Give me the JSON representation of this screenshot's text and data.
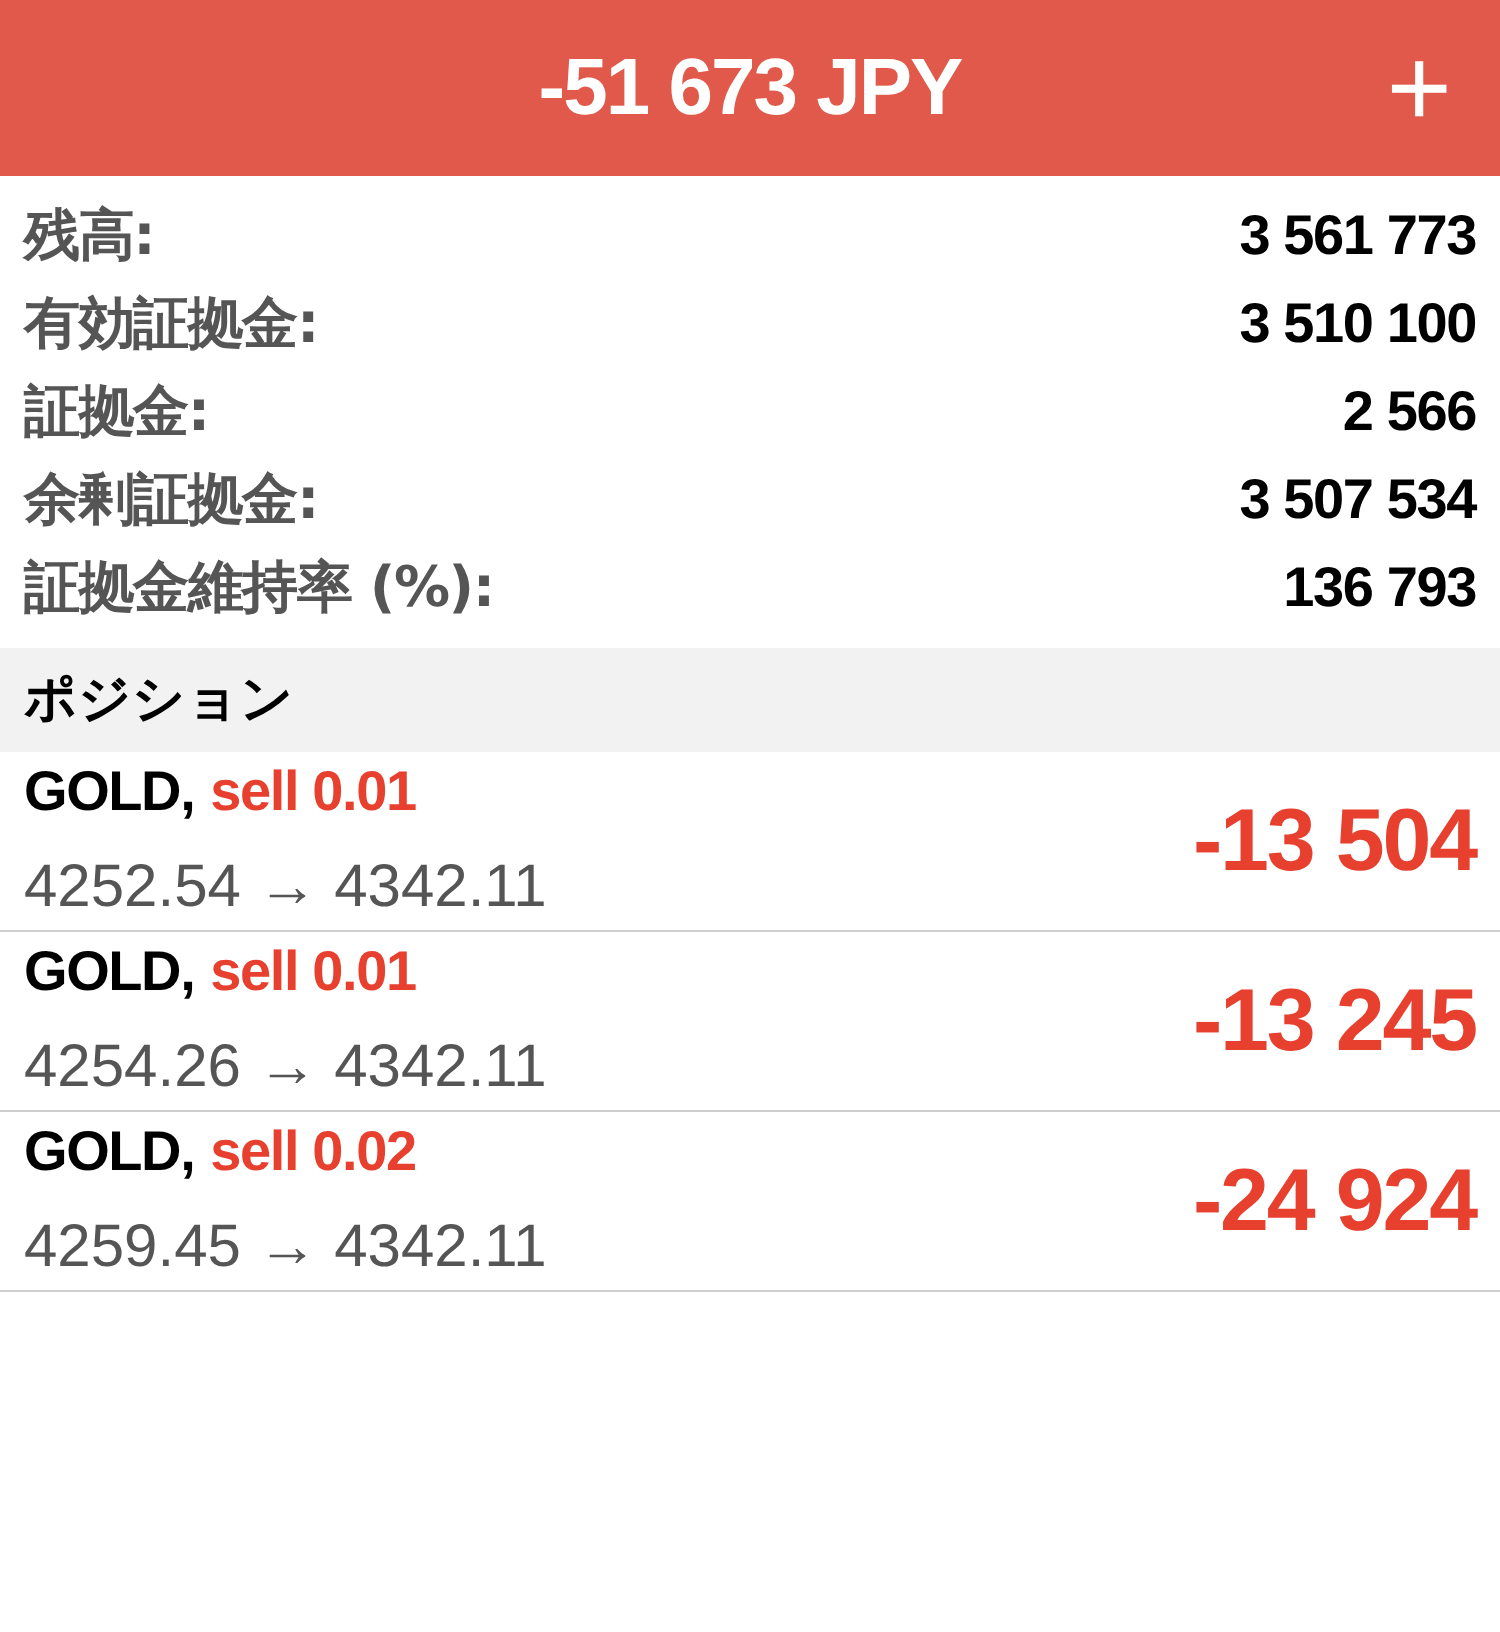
{
  "header": {
    "title": "-51 673 JPY",
    "add_button": "+"
  },
  "account": [
    {
      "label": "残高:",
      "value": "3 561 773"
    },
    {
      "label": "有効証拠金:",
      "value": "3 510 100"
    },
    {
      "label": "証拠金:",
      "value": "2 566"
    },
    {
      "label": "余剰証拠金:",
      "value": "3 507 534"
    },
    {
      "label": "証拠金維持率 (%):",
      "value": "136 793"
    }
  ],
  "positions_section": {
    "title": "ポジション"
  },
  "positions": [
    {
      "symbol": "GOLD,",
      "type": "sell 0.01",
      "prices": "4252.54 → 4342.11",
      "profit": "-13 504"
    },
    {
      "symbol": "GOLD,",
      "type": "sell 0.01",
      "prices": "4254.26 → 4342.11",
      "profit": "-13 245"
    },
    {
      "symbol": "GOLD,",
      "type": "sell 0.02",
      "prices": "4259.45 → 4342.11",
      "profit": "-24 924"
    }
  ]
}
